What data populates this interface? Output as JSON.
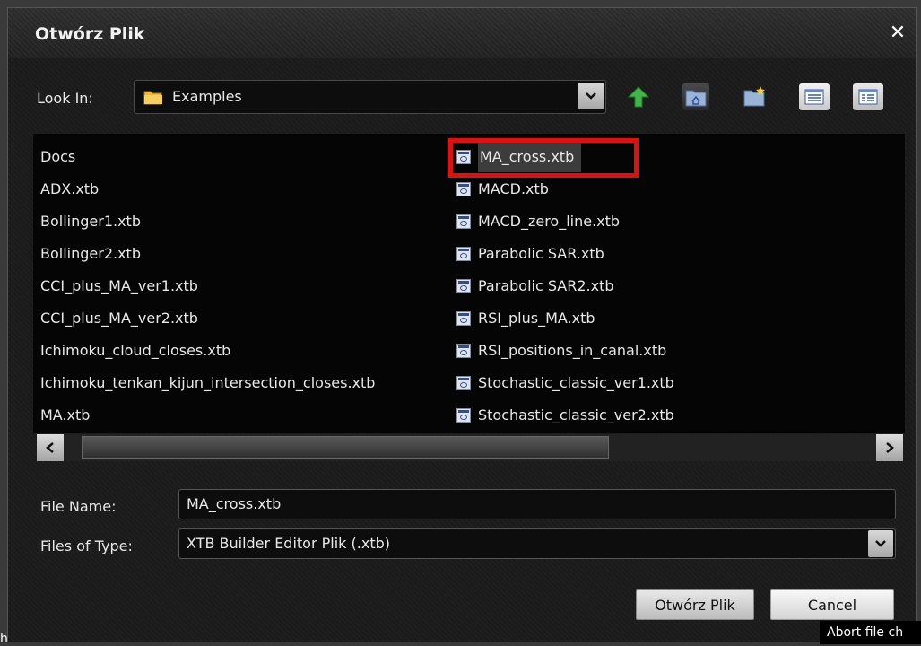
{
  "dialog": {
    "title": "Otwórz Plik",
    "close_glyph": "✕"
  },
  "lookin": {
    "label": "Look In:",
    "value": "Examples",
    "icons": [
      "folder-icon",
      "chevron-down-icon"
    ]
  },
  "toolbar": {
    "icons": [
      "up-folder-icon",
      "home-folder-icon",
      "new-folder-icon",
      "list-view-icon",
      "details-view-icon"
    ],
    "colors": {
      "up_arrow": "#3fb54a",
      "folder": "#f0b83a",
      "view_active": "#6a88c8"
    }
  },
  "files": {
    "column1": [
      "Docs",
      "ADX.xtb",
      "Bollinger1.xtb",
      "Bollinger2.xtb",
      "CCI_plus_MA_ver1.xtb",
      "CCI_plus_MA_ver2.xtb",
      "Ichimoku_cloud_closes.xtb",
      "Ichimoku_tenkan_kijun_intersection_closes.xtb",
      "MA.xtb"
    ],
    "column2": [
      "MA_cross.xtb",
      "MACD.xtb",
      "MACD_zero_line.xtb",
      "Parabolic SAR.xtb",
      "Parabolic SAR2.xtb",
      "RSI_plus_MA.xtb",
      "RSI_positions_in_canal.xtb",
      "Stochastic_classic_ver1.xtb",
      "Stochastic_classic_ver2.xtb"
    ],
    "selected": "MA_cross.xtb",
    "highlight_color": "#e01010"
  },
  "scrollbar": {
    "left_glyph": "‹",
    "right_glyph": "›"
  },
  "filename": {
    "label": "File Name:",
    "value": "MA_cross.xtb"
  },
  "filetype": {
    "label": "Files of Type:",
    "value": "XTB Builder Editor Plik (.xtb)"
  },
  "buttons": {
    "open_label": "Otwórz Plik",
    "cancel_label": "Cancel"
  },
  "tooltip": {
    "text": "Abort file ch"
  },
  "edge_text": "h"
}
